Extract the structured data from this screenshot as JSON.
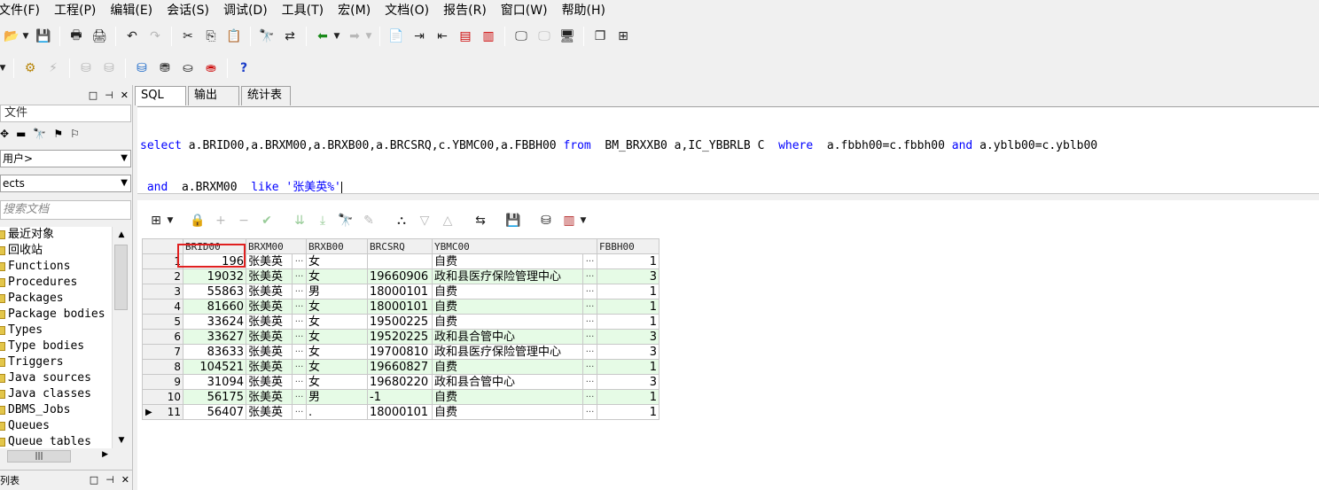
{
  "menu": [
    "文件(F)",
    "工程(P)",
    "编辑(E)",
    "会话(S)",
    "调试(D)",
    "工具(T)",
    "宏(M)",
    "文档(O)",
    "报告(R)",
    "窗口(W)",
    "帮助(H)"
  ],
  "left_panel": {
    "tab_label": "文件",
    "user_combo": "用户>",
    "objects_combo": "ects",
    "search_placeholder": "搜索文档",
    "tree_items": [
      "最近对象",
      "回收站",
      "Functions",
      "Procedures",
      "Packages",
      "Package bodies",
      "Types",
      "Type bodies",
      "Triggers",
      "Java sources",
      "Java classes",
      "DBMS_Jobs",
      "Queues",
      "Queue tables"
    ],
    "footer_label": "列表"
  },
  "sql_tabs": [
    "SQL",
    "输出",
    "统计表"
  ],
  "sql": {
    "line1": {
      "kw_select": "select",
      "cols": " a.BRID00,a.BRXM00,a.BRXB00,a.BRCSRQ,c.YBMC00,a.FBBH00 ",
      "kw_from": "from",
      "tables": "  BM_BRXXB0 a,IC_YBBRLB C  ",
      "kw_where": "where",
      "cond1": "  a.fbbh00=c.fbbh00 ",
      "kw_and": "and",
      "cond2": " a.yblb00=c.yblb00"
    },
    "line2": {
      "kw_and": " and",
      "col": "  a.BRXM00  ",
      "kw_like": "like",
      "str": " '张美英%'"
    }
  },
  "grid": {
    "columns": [
      "BRID00",
      "BRXM00",
      "BRXB00",
      "BRCSRQ",
      "YBMC00",
      "FBBH00"
    ],
    "ellipsis": "···",
    "rows": [
      {
        "n": "1",
        "brid": "196",
        "name": "张美英",
        "sex": "女",
        "date": "",
        "ybmc": "自费",
        "fbbh": "1"
      },
      {
        "n": "2",
        "brid": "19032",
        "name": "张美英",
        "sex": "女",
        "date": "19660906",
        "ybmc": "政和县医疗保险管理中心",
        "fbbh": "3"
      },
      {
        "n": "3",
        "brid": "55863",
        "name": "张美英",
        "sex": "男",
        "date": "18000101",
        "ybmc": "自费",
        "fbbh": "1"
      },
      {
        "n": "4",
        "brid": "81660",
        "name": "张美英",
        "sex": "女",
        "date": "18000101",
        "ybmc": "自费",
        "fbbh": "1"
      },
      {
        "n": "5",
        "brid": "33624",
        "name": "张美英",
        "sex": "女",
        "date": "19500225",
        "ybmc": "自费",
        "fbbh": "1"
      },
      {
        "n": "6",
        "brid": "33627",
        "name": "张美英",
        "sex": "女",
        "date": "19520225",
        "ybmc": "政和县合管中心",
        "fbbh": "3"
      },
      {
        "n": "7",
        "brid": "83633",
        "name": "张美英",
        "sex": "女",
        "date": "19700810",
        "ybmc": "政和县医疗保险管理中心",
        "fbbh": "3"
      },
      {
        "n": "8",
        "brid": "104521",
        "name": "张美英",
        "sex": "女",
        "date": "19660827",
        "ybmc": "自费",
        "fbbh": "1"
      },
      {
        "n": "9",
        "brid": "31094",
        "name": "张美英",
        "sex": "女",
        "date": "19680220",
        "ybmc": "政和县合管中心",
        "fbbh": "3"
      },
      {
        "n": "10",
        "brid": "56175",
        "name": "张美英",
        "sex": "男",
        "date": "-1",
        "ybmc": "自费",
        "fbbh": "1"
      },
      {
        "n": "11",
        "brid": "56407",
        "name": "张美英",
        "sex": ".",
        "date": "18000101",
        "ybmc": "自费",
        "fbbh": "1"
      }
    ],
    "current_row": 10
  },
  "colors": {
    "alt_row": "#e6fbe6",
    "keyword": "#0000ff",
    "highlight_box": "#e02020"
  }
}
